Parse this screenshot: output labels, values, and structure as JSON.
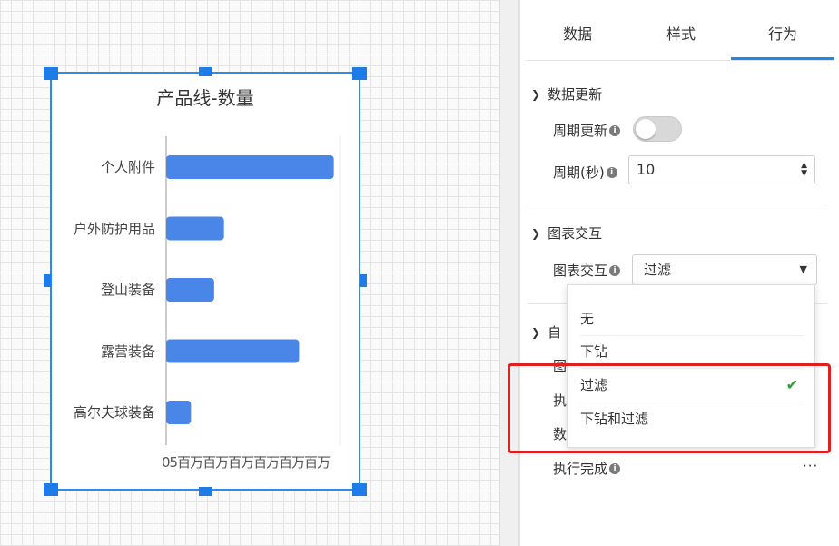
{
  "chart_data": {
    "type": "bar",
    "orientation": "horizontal",
    "title": "产品线-数量",
    "categories": [
      "个人附件",
      "户外防护用品",
      "登山装备",
      "露营装备",
      "高尔夫球装备"
    ],
    "values": [
      29,
      10,
      8.3,
      23,
      4.3
    ],
    "xlim": [
      0,
      30
    ],
    "x_tick_text": "05百万百万百万百万百万百万",
    "bar_color": "#4a86e8",
    "grid": false
  },
  "panel": {
    "tabs": [
      "数据",
      "样式",
      "行为"
    ],
    "active_tab": "行为",
    "sections": {
      "data_refresh": {
        "title": "数据更新",
        "periodic_label": "周期更新",
        "periodic_on": false,
        "period_label": "周期(秒)",
        "period_value": "10"
      },
      "chart_interaction": {
        "title": "图表交互",
        "label": "图表交互",
        "selected": "过滤"
      },
      "hidden_rows": {
        "peek_1": "自",
        "peek_2": "图",
        "peek_3": "执",
        "peek_4": "数"
      },
      "exec_done": {
        "label": "执行完成",
        "more": "···"
      }
    },
    "dropdown_options": [
      "无",
      "下钻",
      "过滤",
      "下钻和过滤"
    ],
    "check_icon": "checkmark-icon",
    "info_icon_glyph": "i",
    "accent": "#1e88e5",
    "highlight_color": "#e02020"
  }
}
